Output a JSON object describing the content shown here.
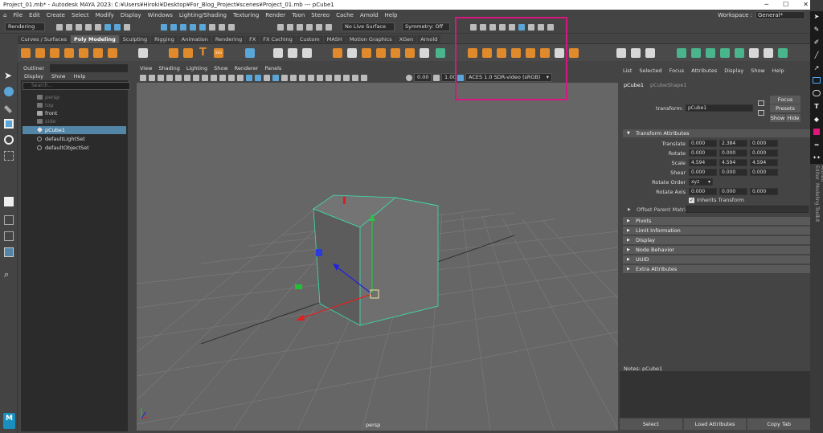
{
  "window": {
    "title": "Project_01.mb* - Autodesk MAYA 2023: C:¥Users¥Hiroki¥Desktop¥For_Blog_Project¥scenes¥Project_01.mb  ---  pCube1"
  },
  "menubar": [
    "File",
    "Edit",
    "Create",
    "Select",
    "Modify",
    "Display",
    "Windows",
    "Lighting/Shading",
    "Texturing",
    "Render",
    "Toon",
    "Stereo",
    "Cache",
    "Arnold",
    "Help"
  ],
  "workspace": {
    "label": "Workspace :",
    "value": "General*"
  },
  "statusline": {
    "mode": "Rendering",
    "live_surface": "No Live Surface",
    "symmetry": "Symmetry: Off"
  },
  "shelf_tabs": [
    "Curves / Surfaces",
    "Poly Modeling",
    "Sculpting",
    "Rigging",
    "Animation",
    "Rendering",
    "FX",
    "FX Caching",
    "Custom",
    "MASH",
    "Motion Graphics",
    "XGen",
    "Arnold"
  ],
  "active_shelf": "Poly Modeling",
  "shelf_text": {
    "svg": "SVG"
  },
  "outliner": {
    "tab": "Outliner",
    "menu": [
      "Display",
      "Show",
      "Help"
    ],
    "search_placeholder": "Search...",
    "items": [
      {
        "name": "persp",
        "state": "dim"
      },
      {
        "name": "top",
        "state": "dim"
      },
      {
        "name": "front",
        "state": "normal"
      },
      {
        "name": "side",
        "state": "dim"
      },
      {
        "name": "pCube1",
        "state": "selected"
      },
      {
        "name": "defaultLightSet",
        "state": "normal"
      },
      {
        "name": "defaultObjectSet",
        "state": "normal"
      }
    ]
  },
  "viewport": {
    "menu": [
      "View",
      "Shading",
      "Lighting",
      "Show",
      "Renderer",
      "Panels"
    ],
    "exposure": "0.00",
    "gamma": "1.00",
    "color_space": "ACES 1.0 SDR-video (sRGB)",
    "camera": "persp"
  },
  "channel_box": {
    "menu": [
      "List",
      "Selected",
      "Focus",
      "Attributes",
      "Display",
      "Show",
      "Help"
    ],
    "tabs": [
      "pCube1",
      "pCubeShape1"
    ],
    "transform_label": "transform:",
    "transform_value": "pCube1",
    "buttons": {
      "focus": "Focus",
      "presets": "Presets",
      "show": "Show",
      "hide": "Hide"
    },
    "transform_section": "Transform Attributes",
    "attributes": [
      {
        "label": "Translate",
        "values": [
          "0.000",
          "2.384",
          "0.000"
        ]
      },
      {
        "label": "Rotate",
        "values": [
          "0.000",
          "0.000",
          "0.000"
        ]
      },
      {
        "label": "Scale",
        "values": [
          "4.594",
          "4.594",
          "4.594"
        ]
      },
      {
        "label": "Shear",
        "values": [
          "0.000",
          "0.000",
          "0.000"
        ]
      }
    ],
    "rotate_order": {
      "label": "Rotate Order",
      "value": "xyz"
    },
    "rotate_axis": {
      "label": "Rotate Axis",
      "values": [
        "0.000",
        "0.000",
        "0.000"
      ]
    },
    "inherits_transform": "Inherits Transform",
    "offset_parent_matrix": "Offset Parent Matrix",
    "sections": [
      "Pivots",
      "Limit Information",
      "Display",
      "Node Behavior",
      "UUID",
      "Extra Attributes"
    ],
    "notes_label": "Notes:  pCube1",
    "bottom_buttons": [
      "Select",
      "Load Attributes",
      "Copy Tab"
    ]
  },
  "side_labels": [
    "Attribute Editor",
    "Modeling Toolkit"
  ],
  "logo": "M",
  "colors": {
    "highlight": "#d6177f",
    "selection": "#5285a6",
    "cube_edge": "#3ce0b0",
    "accent_orange": "#e08a2c"
  }
}
